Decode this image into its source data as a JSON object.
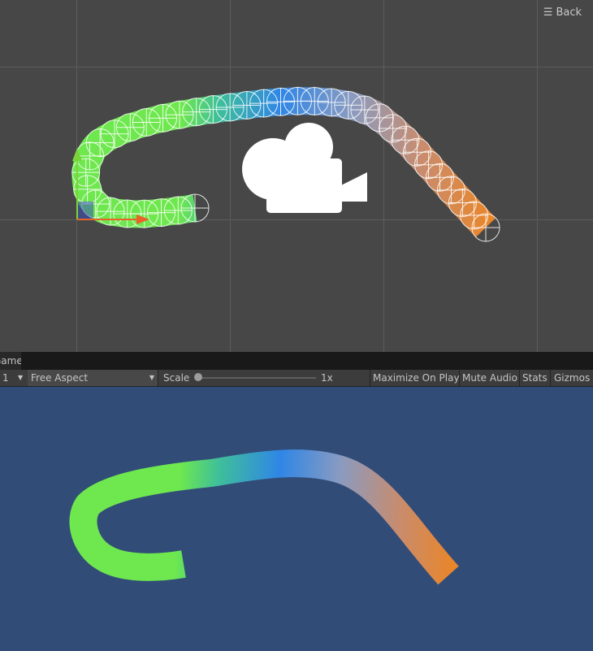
{
  "scene": {
    "back_label": "Back",
    "menu_icon": "hamburger-menu-icon",
    "camera_icon": "camera-gizmo-icon",
    "grid_color": "#5c5c5c",
    "background": "#474747"
  },
  "tabs": {
    "game": "Game"
  },
  "toolbar": {
    "display": "1",
    "aspect": "Free Aspect",
    "scale_label": "Scale",
    "scale_value": "1x",
    "scale_level": 0,
    "maximize_on_play": "Maximize On Play",
    "mute_audio": "Mute Audio",
    "stats": "Stats",
    "gizmos": "Gizmos"
  },
  "game_view": {
    "background": "#324c78"
  },
  "trail_colors": [
    "#6ee84e",
    "#3fbf9a",
    "#2f86e6",
    "#8a9bc0",
    "#c88c6e",
    "#e8862c"
  ]
}
